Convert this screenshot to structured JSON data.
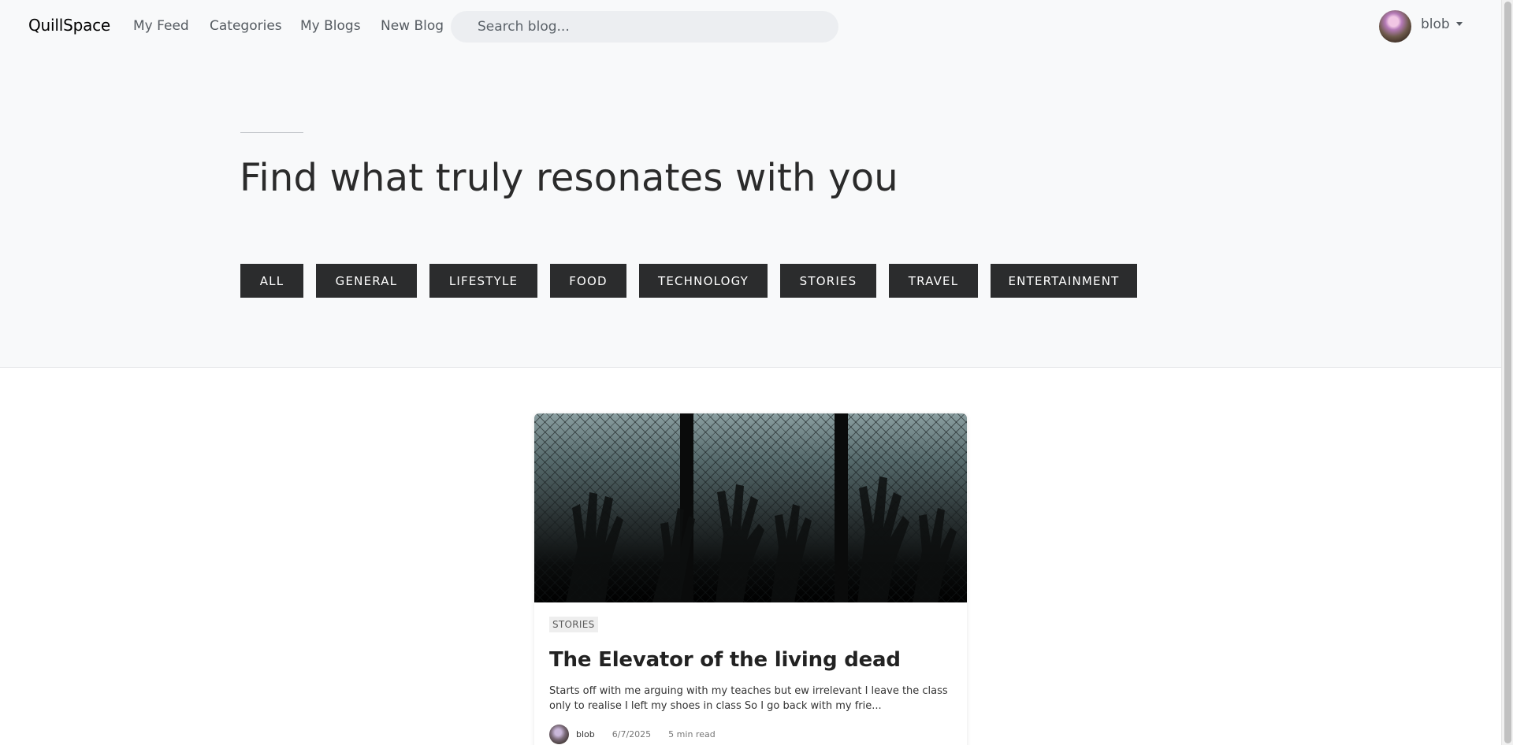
{
  "nav": {
    "brand": "QuillSpace",
    "links": [
      "My Feed",
      "Categories",
      "My Blogs",
      "New Blog"
    ],
    "search_placeholder": "Search blog...",
    "user": {
      "name": "blob",
      "avatar_icon": "user-avatar"
    }
  },
  "hero": {
    "title": "Find what truly resonates with you",
    "categories": [
      "ALL",
      "GENERAL",
      "LIFESTYLE",
      "FOOD",
      "TECHNOLOGY",
      "STORIES",
      "TRAVEL",
      "ENTERTAINMENT"
    ]
  },
  "posts": [
    {
      "category": "STORIES",
      "title": "The Elevator of the living dead",
      "excerpt": "Starts off with me arguing with my teaches but ew irrelevant I leave the class only to realise I left my shoes in class So I go back with my frie...",
      "author": "blob",
      "date": "6/7/2025",
      "read_time": "5 min read"
    }
  ],
  "colors": {
    "nav_bg": "#f8f9fa",
    "button_bg": "#2b2c2d",
    "button_text": "#ffffff",
    "search_bg": "#eceef1"
  }
}
